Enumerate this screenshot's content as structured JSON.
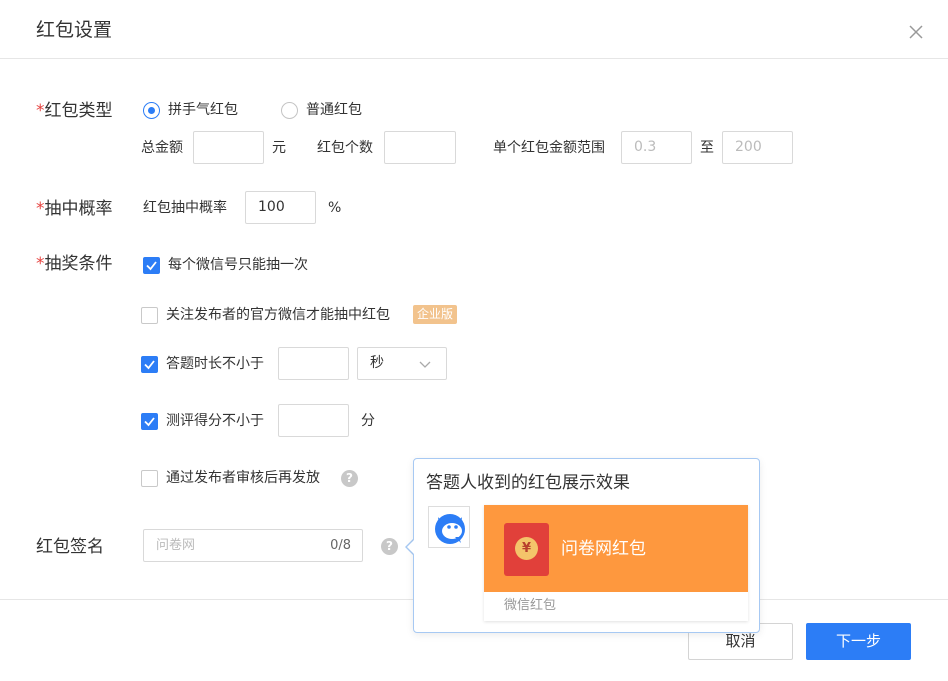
{
  "dialog": {
    "title": "红包设置",
    "close_icon": "close-icon"
  },
  "type_row": {
    "label_required": "*",
    "label": "红包类型",
    "options": [
      {
        "label": "拼手气红包",
        "selected": true
      },
      {
        "label": "普通红包",
        "selected": false
      }
    ],
    "total_amount_label": "总金额",
    "total_amount_value": "",
    "yuan_unit": "元",
    "count_label": "红包个数",
    "count_value": "",
    "range_label": "单个红包金额范围",
    "range_min_placeholder": "0.3",
    "range_to": "至",
    "range_max_placeholder": "200"
  },
  "probability_row": {
    "label_required": "*",
    "label": "抽中概率",
    "field_label": "红包抽中概率",
    "value": "100",
    "unit": "%"
  },
  "conditions_row": {
    "label_required": "*",
    "label": "抽奖条件",
    "once_per_wechat": {
      "label": "每个微信号只能抽一次",
      "checked": true
    },
    "follow_official": {
      "label": "关注发布者的官方微信才能抽中红包",
      "checked": false,
      "badge": "企业版"
    },
    "duration": {
      "label": "答题时长不小于",
      "checked": true,
      "value": "",
      "unit_selected": "秒"
    },
    "score": {
      "label": "测评得分不小于",
      "checked": true,
      "value": "",
      "unit": "分"
    },
    "review": {
      "label": "通过发布者审核后再发放",
      "checked": false
    }
  },
  "signature_row": {
    "label": "红包签名",
    "placeholder": "问卷网",
    "counter": "0/8"
  },
  "preview_popover": {
    "title": "答题人收到的红包展示效果",
    "envelope_symbol": "¥",
    "card_name": "问卷网红包",
    "card_footer": "微信红包"
  },
  "footer": {
    "cancel_label": "取消",
    "next_label": "下一步"
  },
  "colors": {
    "primary": "#2c7df6",
    "required": "#e64340",
    "badge": "#f2c38d",
    "card_orange": "#fe983e",
    "envelope_red": "#e1403a"
  }
}
